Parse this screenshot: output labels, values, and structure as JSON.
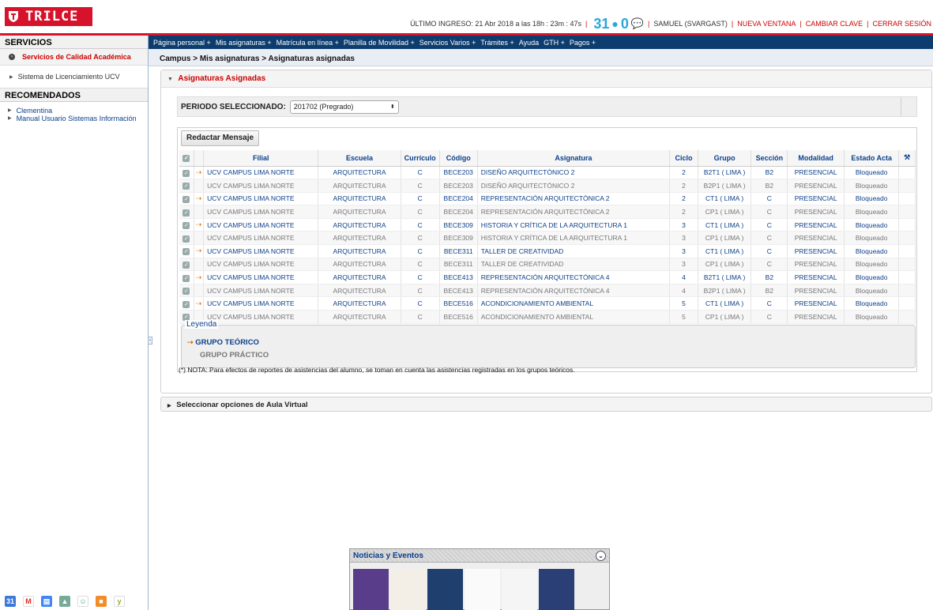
{
  "brand": {
    "name": "TRILCE"
  },
  "topbar": {
    "last_login": "ÚLTIMO INGRESO: 21 Abr 2018 a las 18h : 23m : 47s",
    "calendar_day": "31",
    "notif_count": "0",
    "user": "SAMUEL (SVARGAST)",
    "links": [
      "NUEVA VENTANA",
      "CAMBIAR CLAVE",
      "CERRAR SESIÓN"
    ]
  },
  "sidebar": {
    "services_title": "SERVICIOS",
    "service_item": "Servicios de Calidad Académica",
    "license": "Sistema de Licenciamiento UCV",
    "recommended_title": "RECOMENDADOS",
    "recommended": [
      "Clementina",
      "Manual Usuario Sistemas Información"
    ]
  },
  "menu": [
    "Página personal +",
    "Mis asignaturas +",
    "Matrícula en línea +",
    "Planilla de Movilidad +",
    "Servicios Varios +",
    "Trámites +",
    "Ayuda",
    "GTH +",
    "Pagos +"
  ],
  "breadcrumb": "Campus > Mis asignaturas > Asignaturas asignadas",
  "panel": {
    "title": "Asignaturas Asignadas",
    "period_label": "PERIODO SELECCIONADO:",
    "period_value": "201702 (Pregrado)",
    "compose_button": "Redactar Mensaje"
  },
  "table": {
    "headers": [
      "Filial",
      "Escuela",
      "Currículo",
      "Código",
      "Asignatura",
      "Ciclo",
      "Grupo",
      "Sección",
      "Modalidad",
      "Estado Acta"
    ],
    "rows": [
      {
        "teo": true,
        "filial": "UCV CAMPUS LIMA NORTE",
        "escuela": "ARQUITECTURA",
        "cur": "C",
        "cod": "BECE203",
        "asig": "DISEÑO ARQUITECTÓNICO 2",
        "ciclo": "2",
        "grupo": "B2T1 ( LIMA )",
        "sec": "B2",
        "mod": "PRESENCIAL",
        "est": "Bloqueado"
      },
      {
        "teo": false,
        "filial": "UCV CAMPUS LIMA NORTE",
        "escuela": "ARQUITECTURA",
        "cur": "C",
        "cod": "BECE203",
        "asig": "DISEÑO ARQUITECTÓNICO 2",
        "ciclo": "2",
        "grupo": "B2P1 ( LIMA )",
        "sec": "B2",
        "mod": "PRESENCIAL",
        "est": "Bloqueado"
      },
      {
        "teo": true,
        "filial": "UCV CAMPUS LIMA NORTE",
        "escuela": "ARQUITECTURA",
        "cur": "C",
        "cod": "BECE204",
        "asig": "REPRESENTACIÓN ARQUITECTÓNICA 2",
        "ciclo": "2",
        "grupo": "CT1 ( LIMA )",
        "sec": "C",
        "mod": "PRESENCIAL",
        "est": "Bloqueado"
      },
      {
        "teo": false,
        "filial": "UCV CAMPUS LIMA NORTE",
        "escuela": "ARQUITECTURA",
        "cur": "C",
        "cod": "BECE204",
        "asig": "REPRESENTACIÓN ARQUITECTÓNICA 2",
        "ciclo": "2",
        "grupo": "CP1 ( LIMA )",
        "sec": "C",
        "mod": "PRESENCIAL",
        "est": "Bloqueado"
      },
      {
        "teo": true,
        "filial": "UCV CAMPUS LIMA NORTE",
        "escuela": "ARQUITECTURA",
        "cur": "C",
        "cod": "BECE309",
        "asig": "HISTORIA Y CRÍTICA DE LA ARQUITECTURA 1",
        "ciclo": "3",
        "grupo": "CT1 ( LIMA )",
        "sec": "C",
        "mod": "PRESENCIAL",
        "est": "Bloqueado"
      },
      {
        "teo": false,
        "filial": "UCV CAMPUS LIMA NORTE",
        "escuela": "ARQUITECTURA",
        "cur": "C",
        "cod": "BECE309",
        "asig": "HISTORIA Y CRÍTICA DE LA ARQUITECTURA 1",
        "ciclo": "3",
        "grupo": "CP1 ( LIMA )",
        "sec": "C",
        "mod": "PRESENCIAL",
        "est": "Bloqueado"
      },
      {
        "teo": true,
        "filial": "UCV CAMPUS LIMA NORTE",
        "escuela": "ARQUITECTURA",
        "cur": "C",
        "cod": "BECE311",
        "asig": "TALLER DE CREATIVIDAD",
        "ciclo": "3",
        "grupo": "CT1 ( LIMA )",
        "sec": "C",
        "mod": "PRESENCIAL",
        "est": "Bloqueado"
      },
      {
        "teo": false,
        "filial": "UCV CAMPUS LIMA NORTE",
        "escuela": "ARQUITECTURA",
        "cur": "C",
        "cod": "BECE311",
        "asig": "TALLER DE CREATIVIDAD",
        "ciclo": "3",
        "grupo": "CP1 ( LIMA )",
        "sec": "C",
        "mod": "PRESENCIAL",
        "est": "Bloqueado"
      },
      {
        "teo": true,
        "filial": "UCV CAMPUS LIMA NORTE",
        "escuela": "ARQUITECTURA",
        "cur": "C",
        "cod": "BECE413",
        "asig": "REPRESENTACIÓN ARQUITECTÓNICA 4",
        "ciclo": "4",
        "grupo": "B2T1 ( LIMA )",
        "sec": "B2",
        "mod": "PRESENCIAL",
        "est": "Bloqueado"
      },
      {
        "teo": false,
        "filial": "UCV CAMPUS LIMA NORTE",
        "escuela": "ARQUITECTURA",
        "cur": "C",
        "cod": "BECE413",
        "asig": "REPRESENTACIÓN ARQUITECTÓNICA 4",
        "ciclo": "4",
        "grupo": "B2P1 ( LIMA )",
        "sec": "B2",
        "mod": "PRESENCIAL",
        "est": "Bloqueado"
      },
      {
        "teo": true,
        "filial": "UCV CAMPUS LIMA NORTE",
        "escuela": "ARQUITECTURA",
        "cur": "C",
        "cod": "BECE516",
        "asig": "ACONDICIONAMIENTO AMBIENTAL",
        "ciclo": "5",
        "grupo": "CT1 ( LIMA )",
        "sec": "C",
        "mod": "PRESENCIAL",
        "est": "Bloqueado"
      },
      {
        "teo": false,
        "filial": "UCV CAMPUS LIMA NORTE",
        "escuela": "ARQUITECTURA",
        "cur": "C",
        "cod": "BECE516",
        "asig": "ACONDICIONAMIENTO AMBIENTAL",
        "ciclo": "5",
        "grupo": "CP1 ( LIMA )",
        "sec": "C",
        "mod": "PRESENCIAL",
        "est": "Bloqueado"
      }
    ]
  },
  "legend": {
    "title": "Leyenda",
    "theory": "GRUPO TEÓRICO",
    "practice": "GRUPO PRÁCTICO"
  },
  "note": "(*) NOTA: Para efectos de reportes de asistencias del alumno, se toman en cuenta las asistencias registradas en los grupos teóricos.",
  "virtual_panel": "Seleccionar opciones de Aula Virtual",
  "news": {
    "title": "Noticias y Eventos"
  },
  "colors": {
    "brand_red": "#d6132a",
    "menu_blue": "#0d3d6e",
    "link_blue": "#0b3f8a"
  }
}
